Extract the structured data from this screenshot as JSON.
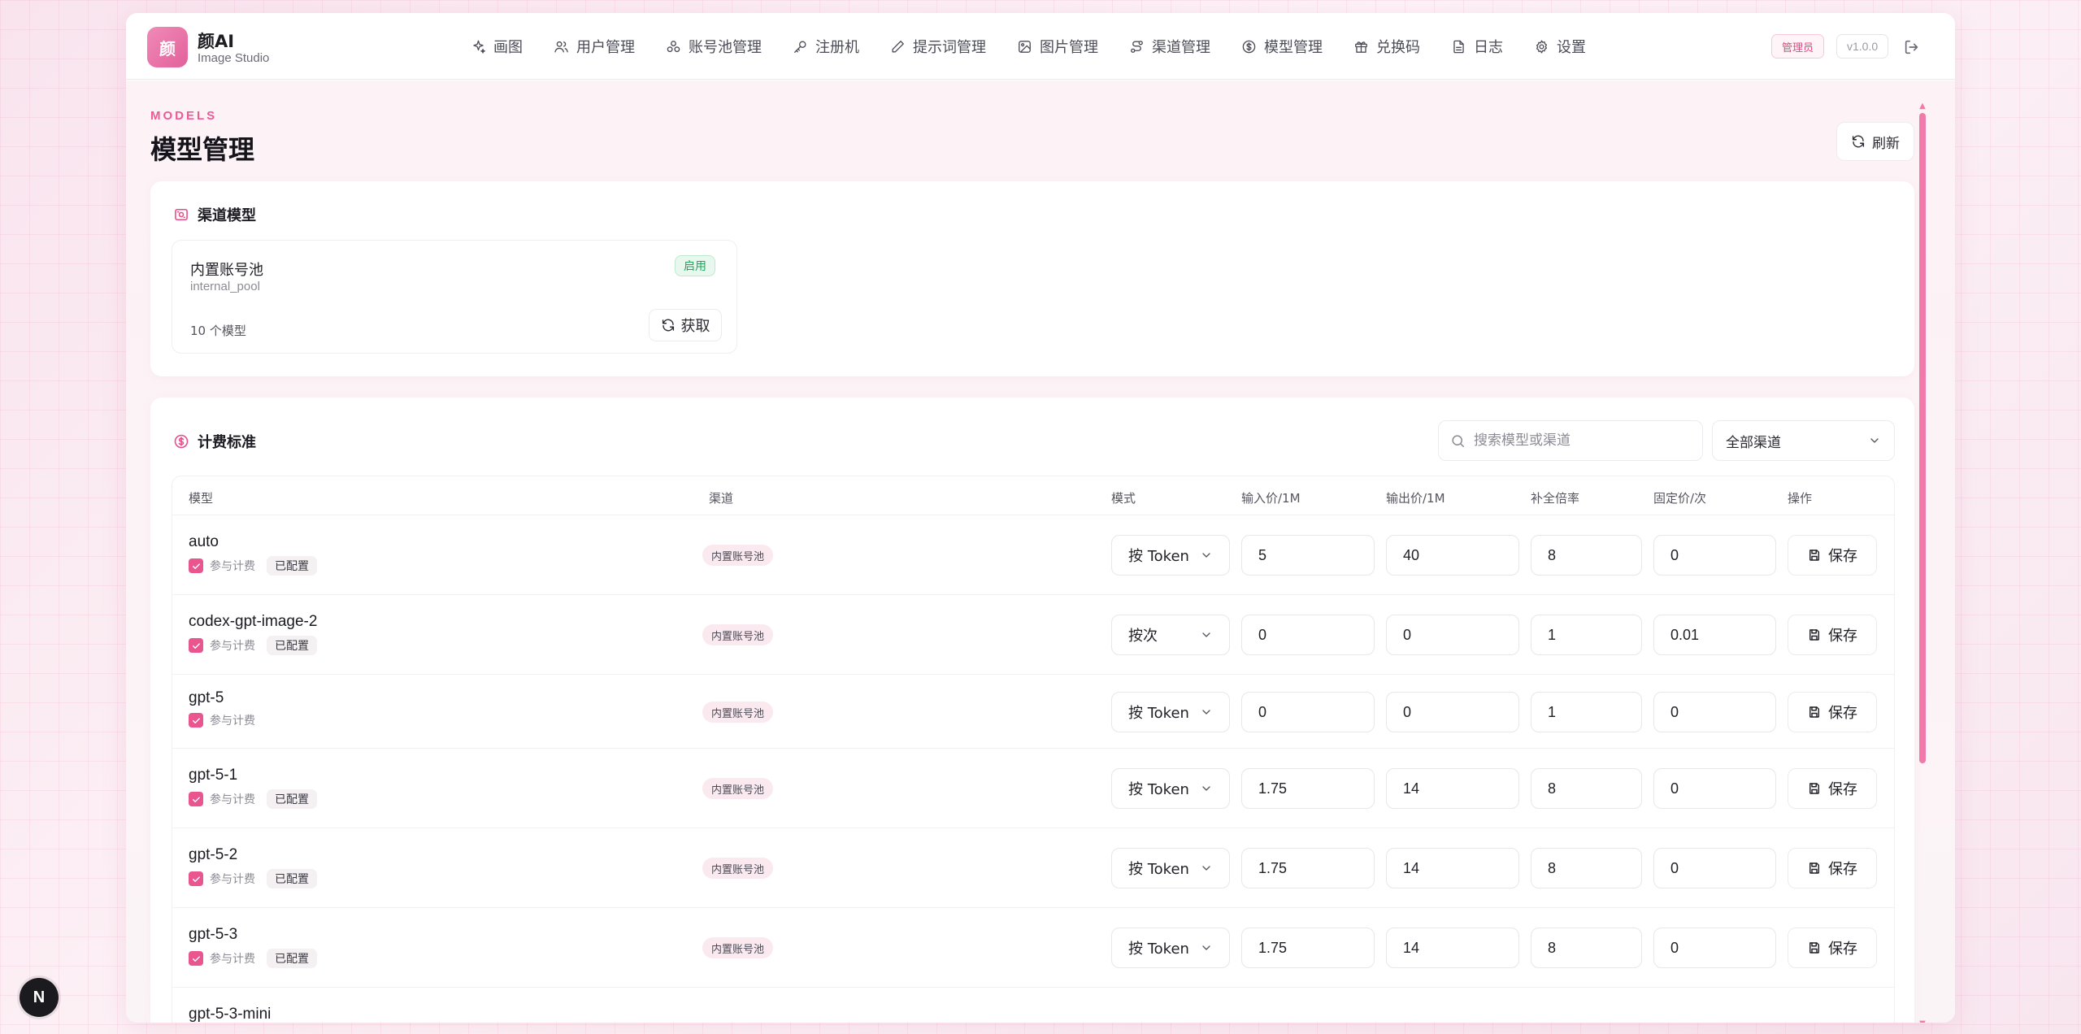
{
  "brand": {
    "logo_char": "颜",
    "name": "颜AI",
    "subtitle": "Image Studio"
  },
  "nav": [
    {
      "label": "画图",
      "icon": "sparkles-icon"
    },
    {
      "label": "用户管理",
      "icon": "users-icon"
    },
    {
      "label": "账号池管理",
      "icon": "pool-icon"
    },
    {
      "label": "注册机",
      "icon": "key-icon"
    },
    {
      "label": "提示词管理",
      "icon": "pen-icon"
    },
    {
      "label": "图片管理",
      "icon": "image-icon"
    },
    {
      "label": "渠道管理",
      "icon": "route-icon"
    },
    {
      "label": "模型管理",
      "icon": "dollar-circle-icon"
    },
    {
      "label": "兑换码",
      "icon": "gift-icon"
    },
    {
      "label": "日志",
      "icon": "file-icon"
    },
    {
      "label": "设置",
      "icon": "gear-icon"
    }
  ],
  "header": {
    "role_badge": "管理员",
    "version": "v1.0.0"
  },
  "page": {
    "eyebrow": "MODELS",
    "title": "模型管理",
    "refresh_label": "刷新"
  },
  "channel_section": {
    "title": "渠道模型",
    "card": {
      "name": "内置账号池",
      "id": "internal_pool",
      "status": "启用",
      "model_count": "10 个模型",
      "fetch_label": "获取"
    }
  },
  "pricing_section": {
    "title": "计费标准",
    "search_placeholder": "搜索模型或渠道",
    "channel_filter": "全部渠道",
    "columns": {
      "model": "模型",
      "channel": "渠道",
      "mode": "模式",
      "input_price": "输入价/1M",
      "output_price": "输出价/1M",
      "completion_ratio": "补全倍率",
      "fixed_price": "固定价/次",
      "actions": "操作"
    },
    "billing_label": "参与计费",
    "configured_label": "已配置",
    "save_label": "保存",
    "rows": [
      {
        "model": "auto",
        "configured": true,
        "channel": "内置账号池",
        "mode": "按 Token",
        "input": "5",
        "output": "40",
        "ratio": "8",
        "fixed": "0"
      },
      {
        "model": "codex-gpt-image-2",
        "configured": true,
        "channel": "内置账号池",
        "mode": "按次",
        "input": "0",
        "output": "0",
        "ratio": "1",
        "fixed": "0.01"
      },
      {
        "model": "gpt-5",
        "configured": false,
        "channel": "内置账号池",
        "mode": "按 Token",
        "input": "0",
        "output": "0",
        "ratio": "1",
        "fixed": "0"
      },
      {
        "model": "gpt-5-1",
        "configured": true,
        "channel": "内置账号池",
        "mode": "按 Token",
        "input": "1.75",
        "output": "14",
        "ratio": "8",
        "fixed": "0"
      },
      {
        "model": "gpt-5-2",
        "configured": true,
        "channel": "内置账号池",
        "mode": "按 Token",
        "input": "1.75",
        "output": "14",
        "ratio": "8",
        "fixed": "0"
      },
      {
        "model": "gpt-5-3",
        "configured": true,
        "channel": "内置账号池",
        "mode": "按 Token",
        "input": "1.75",
        "output": "14",
        "ratio": "8",
        "fixed": "0"
      },
      {
        "model": "gpt-5-3-mini",
        "configured": false,
        "channel": "",
        "mode": "",
        "input": "",
        "output": "",
        "ratio": "",
        "fixed": ""
      }
    ]
  },
  "dev_badge": "N"
}
